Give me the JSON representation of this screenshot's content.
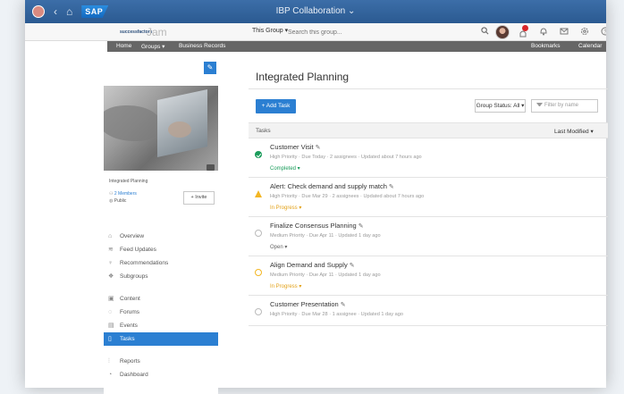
{
  "shell": {
    "title": "IBP Collaboration",
    "logo": "SAP"
  },
  "header": {
    "brand": "successfactors",
    "jam_logo": "Jam",
    "group_select": "This Group",
    "search_placeholder": "Search this group..."
  },
  "nav": {
    "home": "Home",
    "groups": "Groups",
    "business_records": "Business Records",
    "bookmarks": "Bookmarks",
    "calendar": "Calendar"
  },
  "sidebar": {
    "group_name": "Integrated Planning",
    "members": "2 Members",
    "visibility": "Public",
    "invite": "+ Invite",
    "menu": [
      {
        "label": "Overview",
        "icon": "home-icon"
      },
      {
        "label": "Feed Updates",
        "icon": "feed-icon"
      },
      {
        "label": "Recommendations",
        "icon": "bulb-icon"
      },
      {
        "label": "Subgroups",
        "icon": "subgroups-icon"
      },
      {
        "label": "Content",
        "icon": "content-icon"
      },
      {
        "label": "Forums",
        "icon": "forums-icon"
      },
      {
        "label": "Events",
        "icon": "events-icon"
      },
      {
        "label": "Tasks",
        "icon": "tasks-icon",
        "active": true
      },
      {
        "label": "Reports",
        "icon": "reports-icon"
      },
      {
        "label": "Dashboard",
        "icon": "dashboard-icon"
      }
    ]
  },
  "main": {
    "title": "Integrated Planning",
    "add_task": "+ Add Task",
    "group_status": "Group Status: All",
    "filter_placeholder": "Filter by name",
    "tasks_label": "Tasks",
    "sort": "Last Modified",
    "tasks": [
      {
        "title": "Customer Visit",
        "meta": "High Priority · Due Today · 2 assignees · Updated about 7 hours ago",
        "status": "Completed",
        "state": "completed"
      },
      {
        "title": "Alert: Check demand and supply match",
        "meta": "High Priority · Due Mar 29 · 2 assignees · Updated about 7 hours ago",
        "status": "In Progress",
        "state": "alert"
      },
      {
        "title": "Finalize Consensus Planning",
        "meta": "Medium Priority · Due Apr 11 · Updated 1 day ago",
        "status": "Open",
        "state": "open"
      },
      {
        "title": "Align Demand and Supply",
        "meta": "Medium Priority · Due Apr 11 · Updated 1 day ago",
        "status": "In Progress",
        "state": "progress"
      },
      {
        "title": "Customer Presentation",
        "meta": "High Priority · Due Mar 28 · 1 assignee · Updated 1 day ago",
        "status": "",
        "state": "open"
      }
    ]
  },
  "colors": {
    "brand_blue": "#2b7fd2",
    "shell_blue": "#2b5a91",
    "completed": "#1a9c5b",
    "progress": "#e3a21a",
    "nav_gray": "#666666"
  }
}
